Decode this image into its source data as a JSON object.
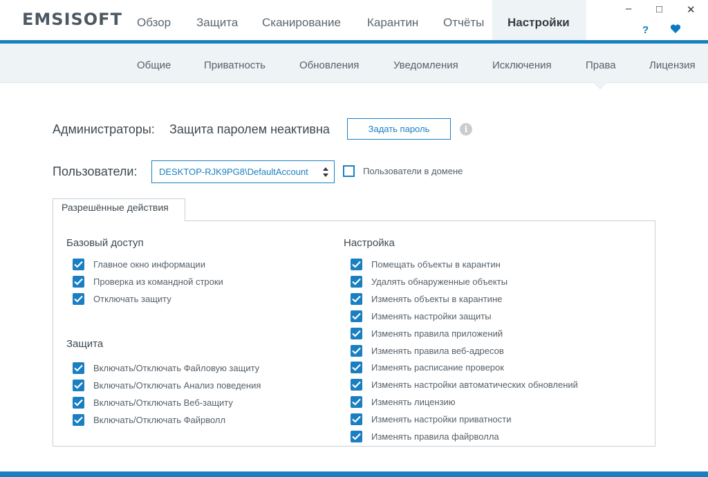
{
  "app": {
    "logo": "EMSISOFT"
  },
  "nav": {
    "items": [
      {
        "label": "Обзор"
      },
      {
        "label": "Защита"
      },
      {
        "label": "Сканирование"
      },
      {
        "label": "Карантин"
      },
      {
        "label": "Отчёты"
      },
      {
        "label": "Настройки"
      }
    ],
    "active": "Настройки"
  },
  "window": {
    "minimize": "–",
    "maximize": "□",
    "close": "✕",
    "help": "?",
    "heart_icon": "heart-icon"
  },
  "subnav": {
    "items": [
      {
        "label": "Общие"
      },
      {
        "label": "Приватность"
      },
      {
        "label": "Обновления"
      },
      {
        "label": "Уведомления"
      },
      {
        "label": "Исключения"
      },
      {
        "label": "Права"
      },
      {
        "label": "Лицензия"
      }
    ],
    "active": "Права"
  },
  "admins": {
    "label": "Администраторы:",
    "status": "Защита паролем неактивна",
    "set_password_button": "Задать пароль",
    "info_icon": "i"
  },
  "users": {
    "label": "Пользователи:",
    "selected": "DESKTOP-RJK9PG8\\DefaultAccount",
    "domain_checkbox_label": "Пользователи в домене",
    "domain_checked": false
  },
  "permissions": {
    "tab_label": "Разрешённые действия",
    "basic": {
      "title": "Базовый доступ",
      "items": [
        {
          "label": "Главное окно информации",
          "checked": true
        },
        {
          "label": "Проверка из командной строки",
          "checked": true
        },
        {
          "label": "Отключать защиту",
          "checked": true
        }
      ]
    },
    "protection": {
      "title": "Защита",
      "items": [
        {
          "label": "Включать/Отключать Файловую защиту",
          "checked": true
        },
        {
          "label": "Включать/Отключать Анализ поведения",
          "checked": true
        },
        {
          "label": "Включать/Отключать Веб-защиту",
          "checked": true
        },
        {
          "label": "Включать/Отключать Файрволл",
          "checked": true
        }
      ]
    },
    "settings": {
      "title": "Настройка",
      "items": [
        {
          "label": "Помещать объекты в карантин",
          "checked": true
        },
        {
          "label": "Удалять обнаруженные объекты",
          "checked": true
        },
        {
          "label": "Изменять объекты в карантине",
          "checked": true
        },
        {
          "label": "Изменять настройки защиты",
          "checked": true
        },
        {
          "label": "Изменять правила приложений",
          "checked": true
        },
        {
          "label": "Изменять правила веб-адресов",
          "checked": true
        },
        {
          "label": "Изменять расписание проверок",
          "checked": true
        },
        {
          "label": "Изменять настройки автоматических обновлений",
          "checked": true
        },
        {
          "label": "Изменять лицензию",
          "checked": true
        },
        {
          "label": "Изменять настройки приватности",
          "checked": true
        },
        {
          "label": "Изменять правила файрволла",
          "checked": true
        }
      ]
    }
  },
  "colors": {
    "accent": "#1a7fc1",
    "subnav_bg": "#eef3f5"
  }
}
